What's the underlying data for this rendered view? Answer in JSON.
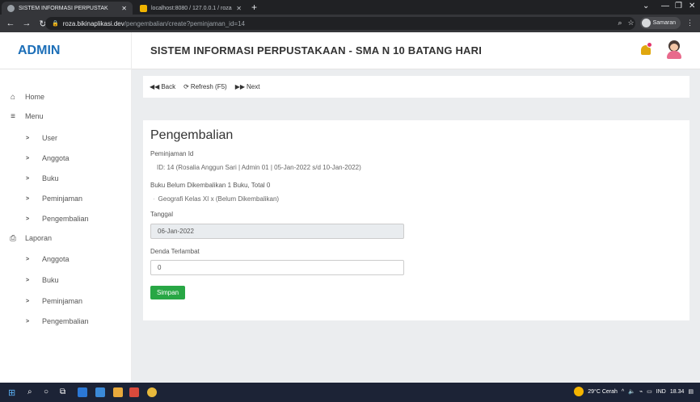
{
  "browser": {
    "tabs": [
      {
        "title": "SISTEM INFORMASI PERPUSTAK",
        "active": true
      },
      {
        "title": "localhost:8080 / 127.0.0.1 / roza",
        "active": false
      }
    ],
    "url_host": "roza.bikinaplikasi.dev",
    "url_path": "/pengembalian/create?peminjaman_id=14",
    "profile_name": "Samaran"
  },
  "header": {
    "brand": "ADMIN",
    "title": "SISTEM INFORMASI PERPUSTAKAAN - SMA N 10 BATANG HARI"
  },
  "sidebar": {
    "items": [
      {
        "label": "Home",
        "icon": "home-icon",
        "glyph": "⌂"
      },
      {
        "label": "Menu",
        "icon": "menu-icon",
        "glyph": "≡"
      },
      {
        "label": "User",
        "icon": "chevron-right-icon",
        "glyph": ">"
      },
      {
        "label": "Anggota",
        "icon": "chevron-right-icon",
        "glyph": ">"
      },
      {
        "label": "Buku",
        "icon": "chevron-right-icon",
        "glyph": ">"
      },
      {
        "label": "Peminjaman",
        "icon": "chevron-right-icon",
        "glyph": ">"
      },
      {
        "label": "Pengembalian",
        "icon": "chevron-right-icon",
        "glyph": ">"
      },
      {
        "label": "Laporan",
        "icon": "print-icon",
        "glyph": "⎙"
      },
      {
        "label": "Anggota",
        "icon": "chevron-right-icon",
        "glyph": ">"
      },
      {
        "label": "Buku",
        "icon": "chevron-right-icon",
        "glyph": ">"
      },
      {
        "label": "Peminjaman",
        "icon": "chevron-right-icon",
        "glyph": ">"
      },
      {
        "label": "Pengembalian",
        "icon": "chevron-right-icon",
        "glyph": ">"
      }
    ]
  },
  "toolbar": {
    "back_label": "Back",
    "refresh_label": "Refresh (F5)",
    "next_label": "Next"
  },
  "form": {
    "heading": "Pengembalian",
    "peminjaman_label": "Peminjaman Id",
    "peminjaman_value": "ID: 14 (Rosalia Anggun Sari | Admin 01 | 05-Jan-2022 s/d 10-Jan-2022)",
    "books_label": "Buku Belum Dikembalikan 1 Buku, Total 0",
    "books_item": "Geografi Kelas XI x (Belum Dikembalikan)",
    "tanggal_label": "Tanggal",
    "tanggal_value": "06-Jan-2022",
    "denda_label": "Denda Terlambat",
    "denda_value": "0",
    "submit_label": "Simpan"
  },
  "taskbar": {
    "weather": "29°C Cerah",
    "lang": "IND",
    "time": "18.34"
  },
  "colors": {
    "brand": "#1d6fb8",
    "save_button": "#28a745",
    "content_bg": "#ebedef"
  }
}
